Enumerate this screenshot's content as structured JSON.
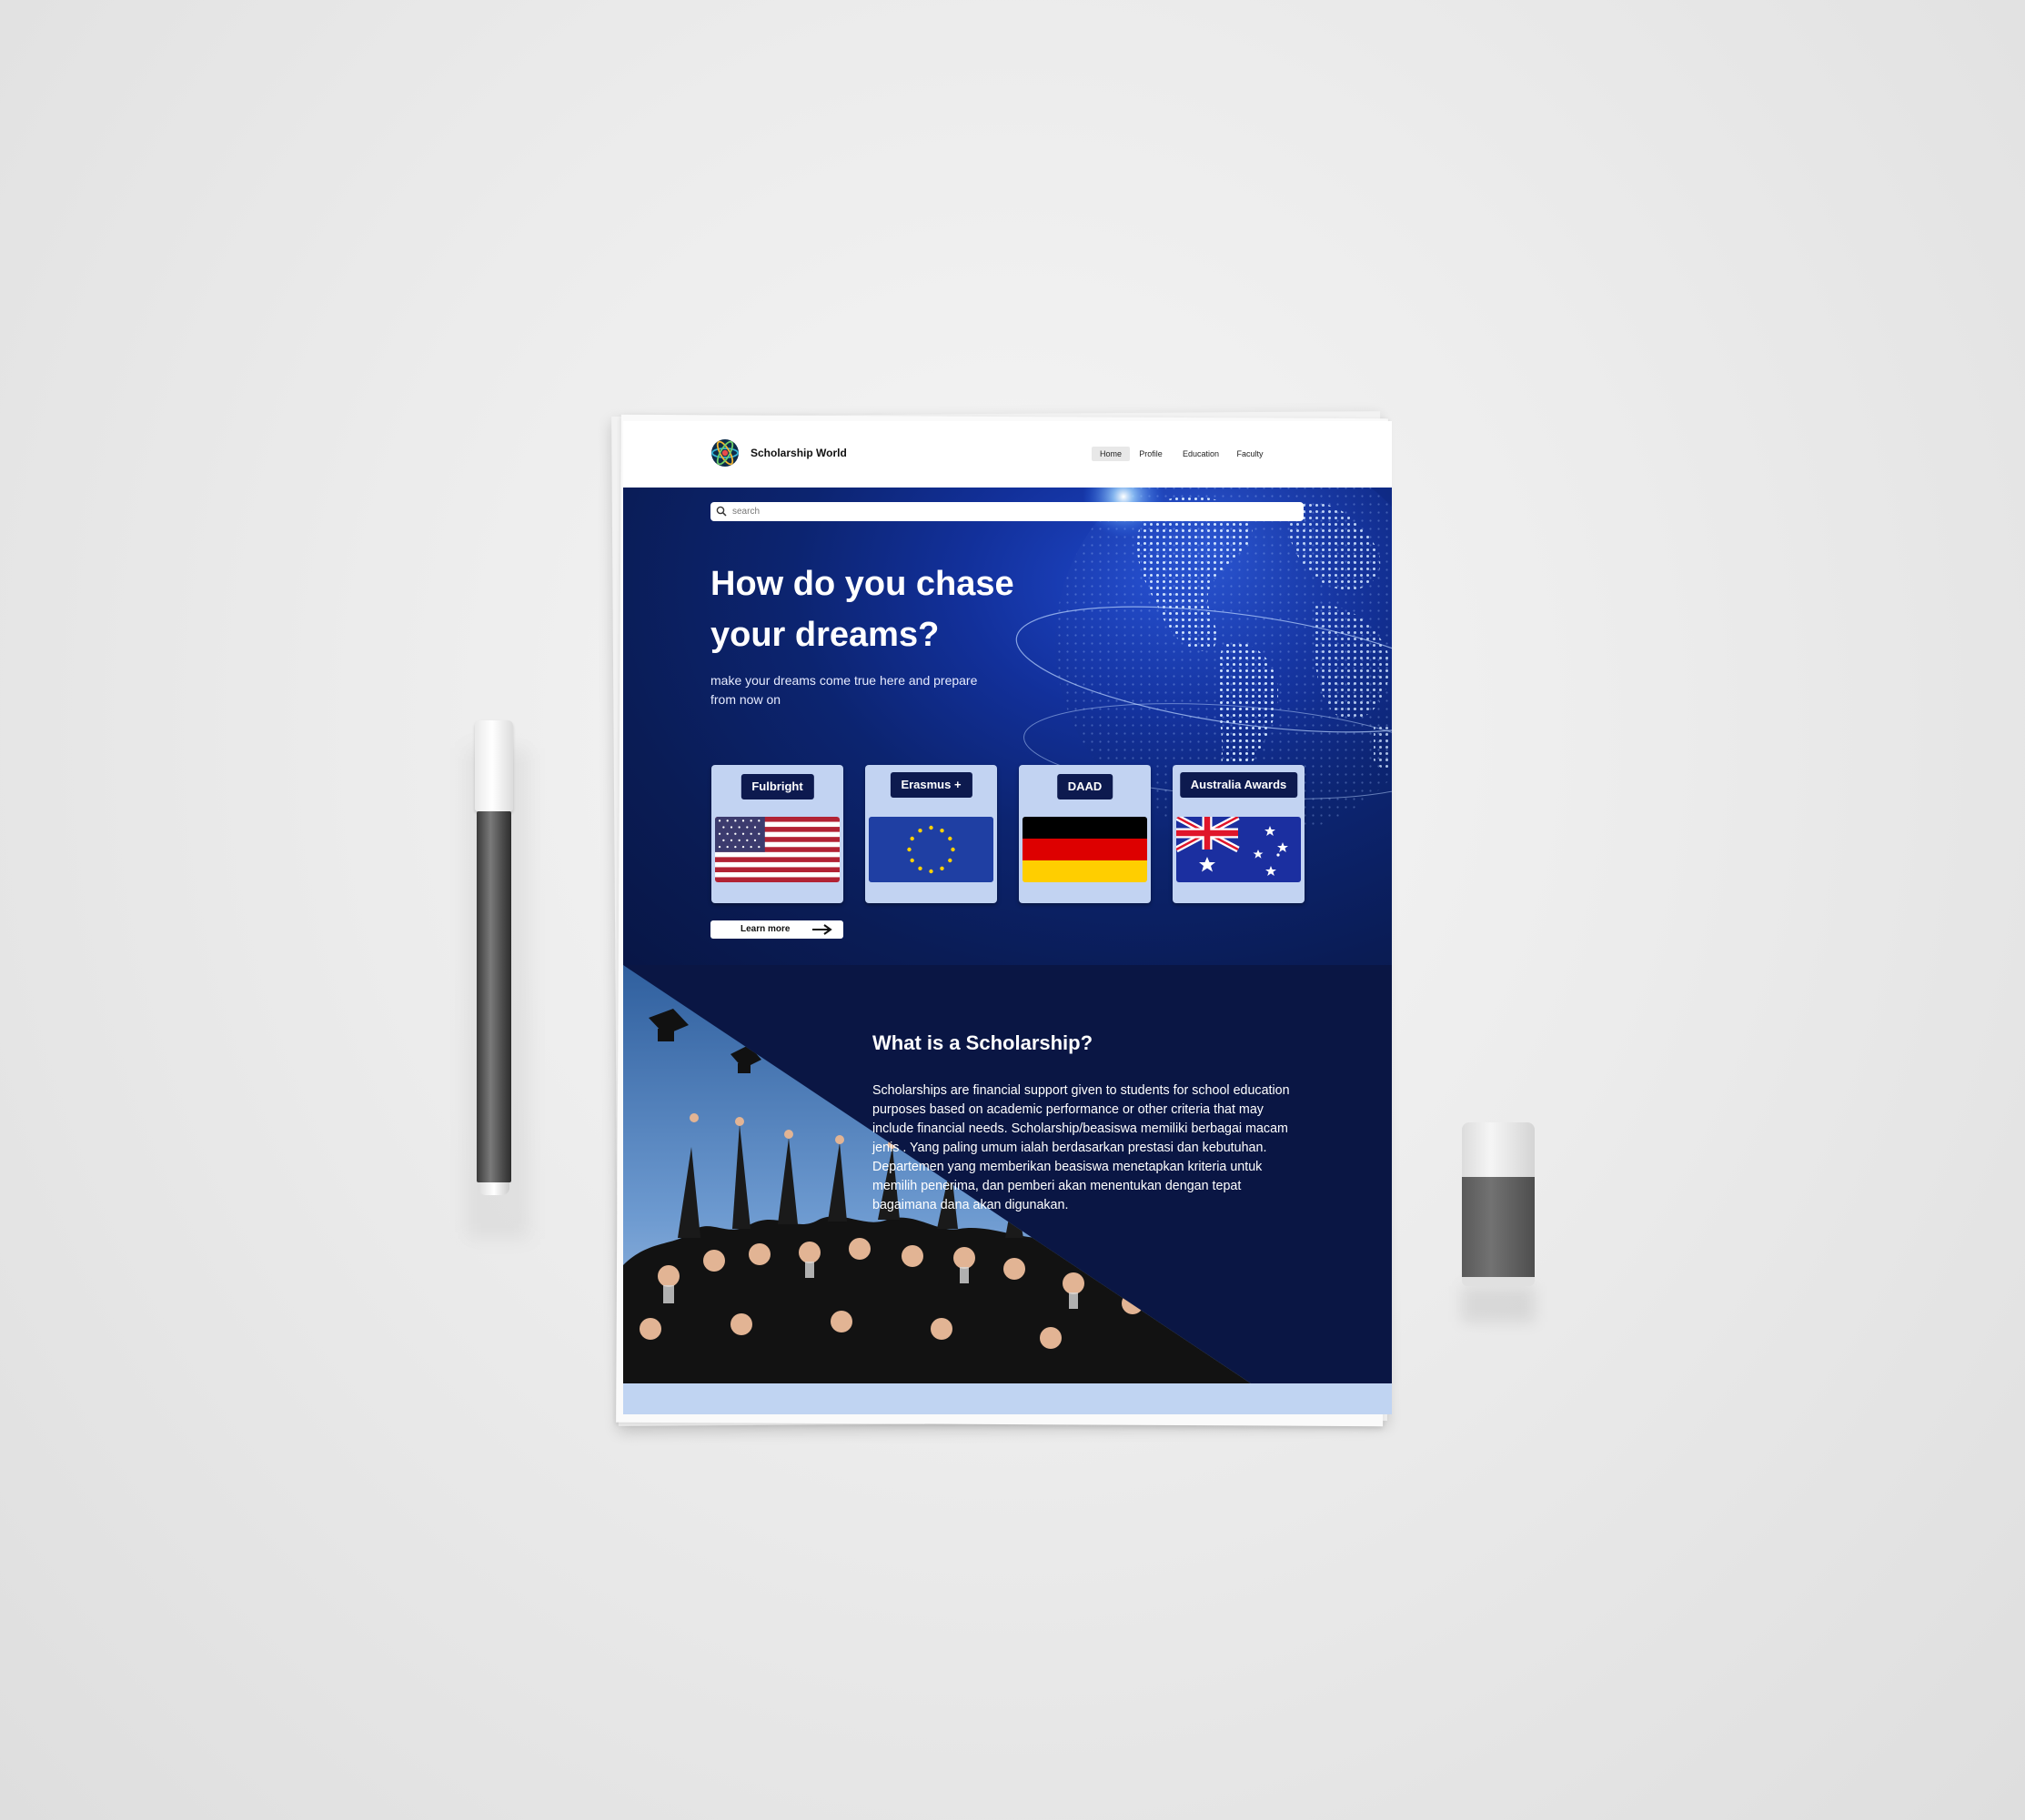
{
  "header": {
    "brand": "Scholarship World",
    "nav": [
      {
        "label": "Home",
        "active": true
      },
      {
        "label": "Profile",
        "active": false
      },
      {
        "label": "Education",
        "active": false
      },
      {
        "label": "Faculty",
        "active": false
      }
    ]
  },
  "search": {
    "placeholder": "search"
  },
  "hero": {
    "title": "How do you chase your dreams?",
    "subtitle": "make your dreams come true here and prepare from now on"
  },
  "scholarships": [
    {
      "label": "Fulbright",
      "flag": "usa-flag"
    },
    {
      "label": "Erasmus +",
      "flag": "eu-flag"
    },
    {
      "label": "DAAD",
      "flag": "germany-flag"
    },
    {
      "label": "Australia Awards",
      "flag": "australia-flag"
    }
  ],
  "learn_more": {
    "label": "Learn more",
    "icon": "arrow-right-icon"
  },
  "about": {
    "title": "What is a Scholarship?",
    "body": "Scholarships are financial support given to students for school education purposes based on academic performance or other criteria that may include financial needs. Scholarship/beasiswa memiliki berbagai macam jenis . Yang paling umum ialah berdasarkan prestasi dan kebutuhan. Departemen yang memberikan beasiswa menetapkan kriteria untuk memilih penerima, dan pemberi akan menentukan dengan tepat bagaimana dana akan digunakan."
  },
  "colors": {
    "hero_bg": "#0c2470",
    "about_bg": "#0a1644",
    "card_bg": "#c2d3f2",
    "label_bg": "#0d1a4f",
    "footer_band": "#c0d4f2"
  }
}
